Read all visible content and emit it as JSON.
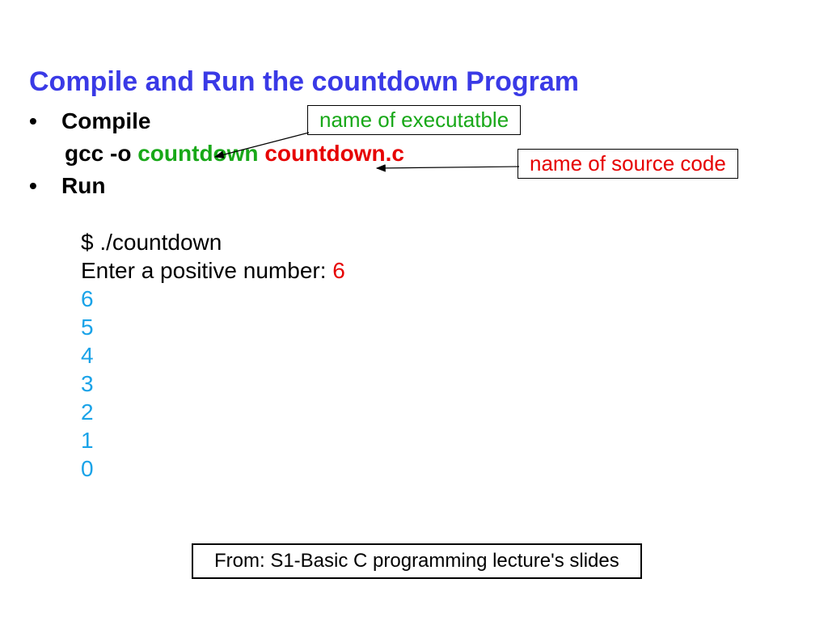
{
  "title": "Compile and Run the countdown Program",
  "bullets": {
    "compile": "Compile",
    "run": "Run"
  },
  "command": {
    "prefix": "gcc -o ",
    "exec": "countdown",
    "src": "countdown.c"
  },
  "callouts": {
    "exec": "name of executatble",
    "src": "name of source code"
  },
  "terminal": {
    "cmd": "$ ./countdown",
    "prompt": "Enter a positive number: ",
    "input": "6",
    "output": [
      "6",
      "5",
      "4",
      "3",
      "2",
      "1",
      "0"
    ]
  },
  "footer": "From: S1-Basic C programming lecture's slides"
}
